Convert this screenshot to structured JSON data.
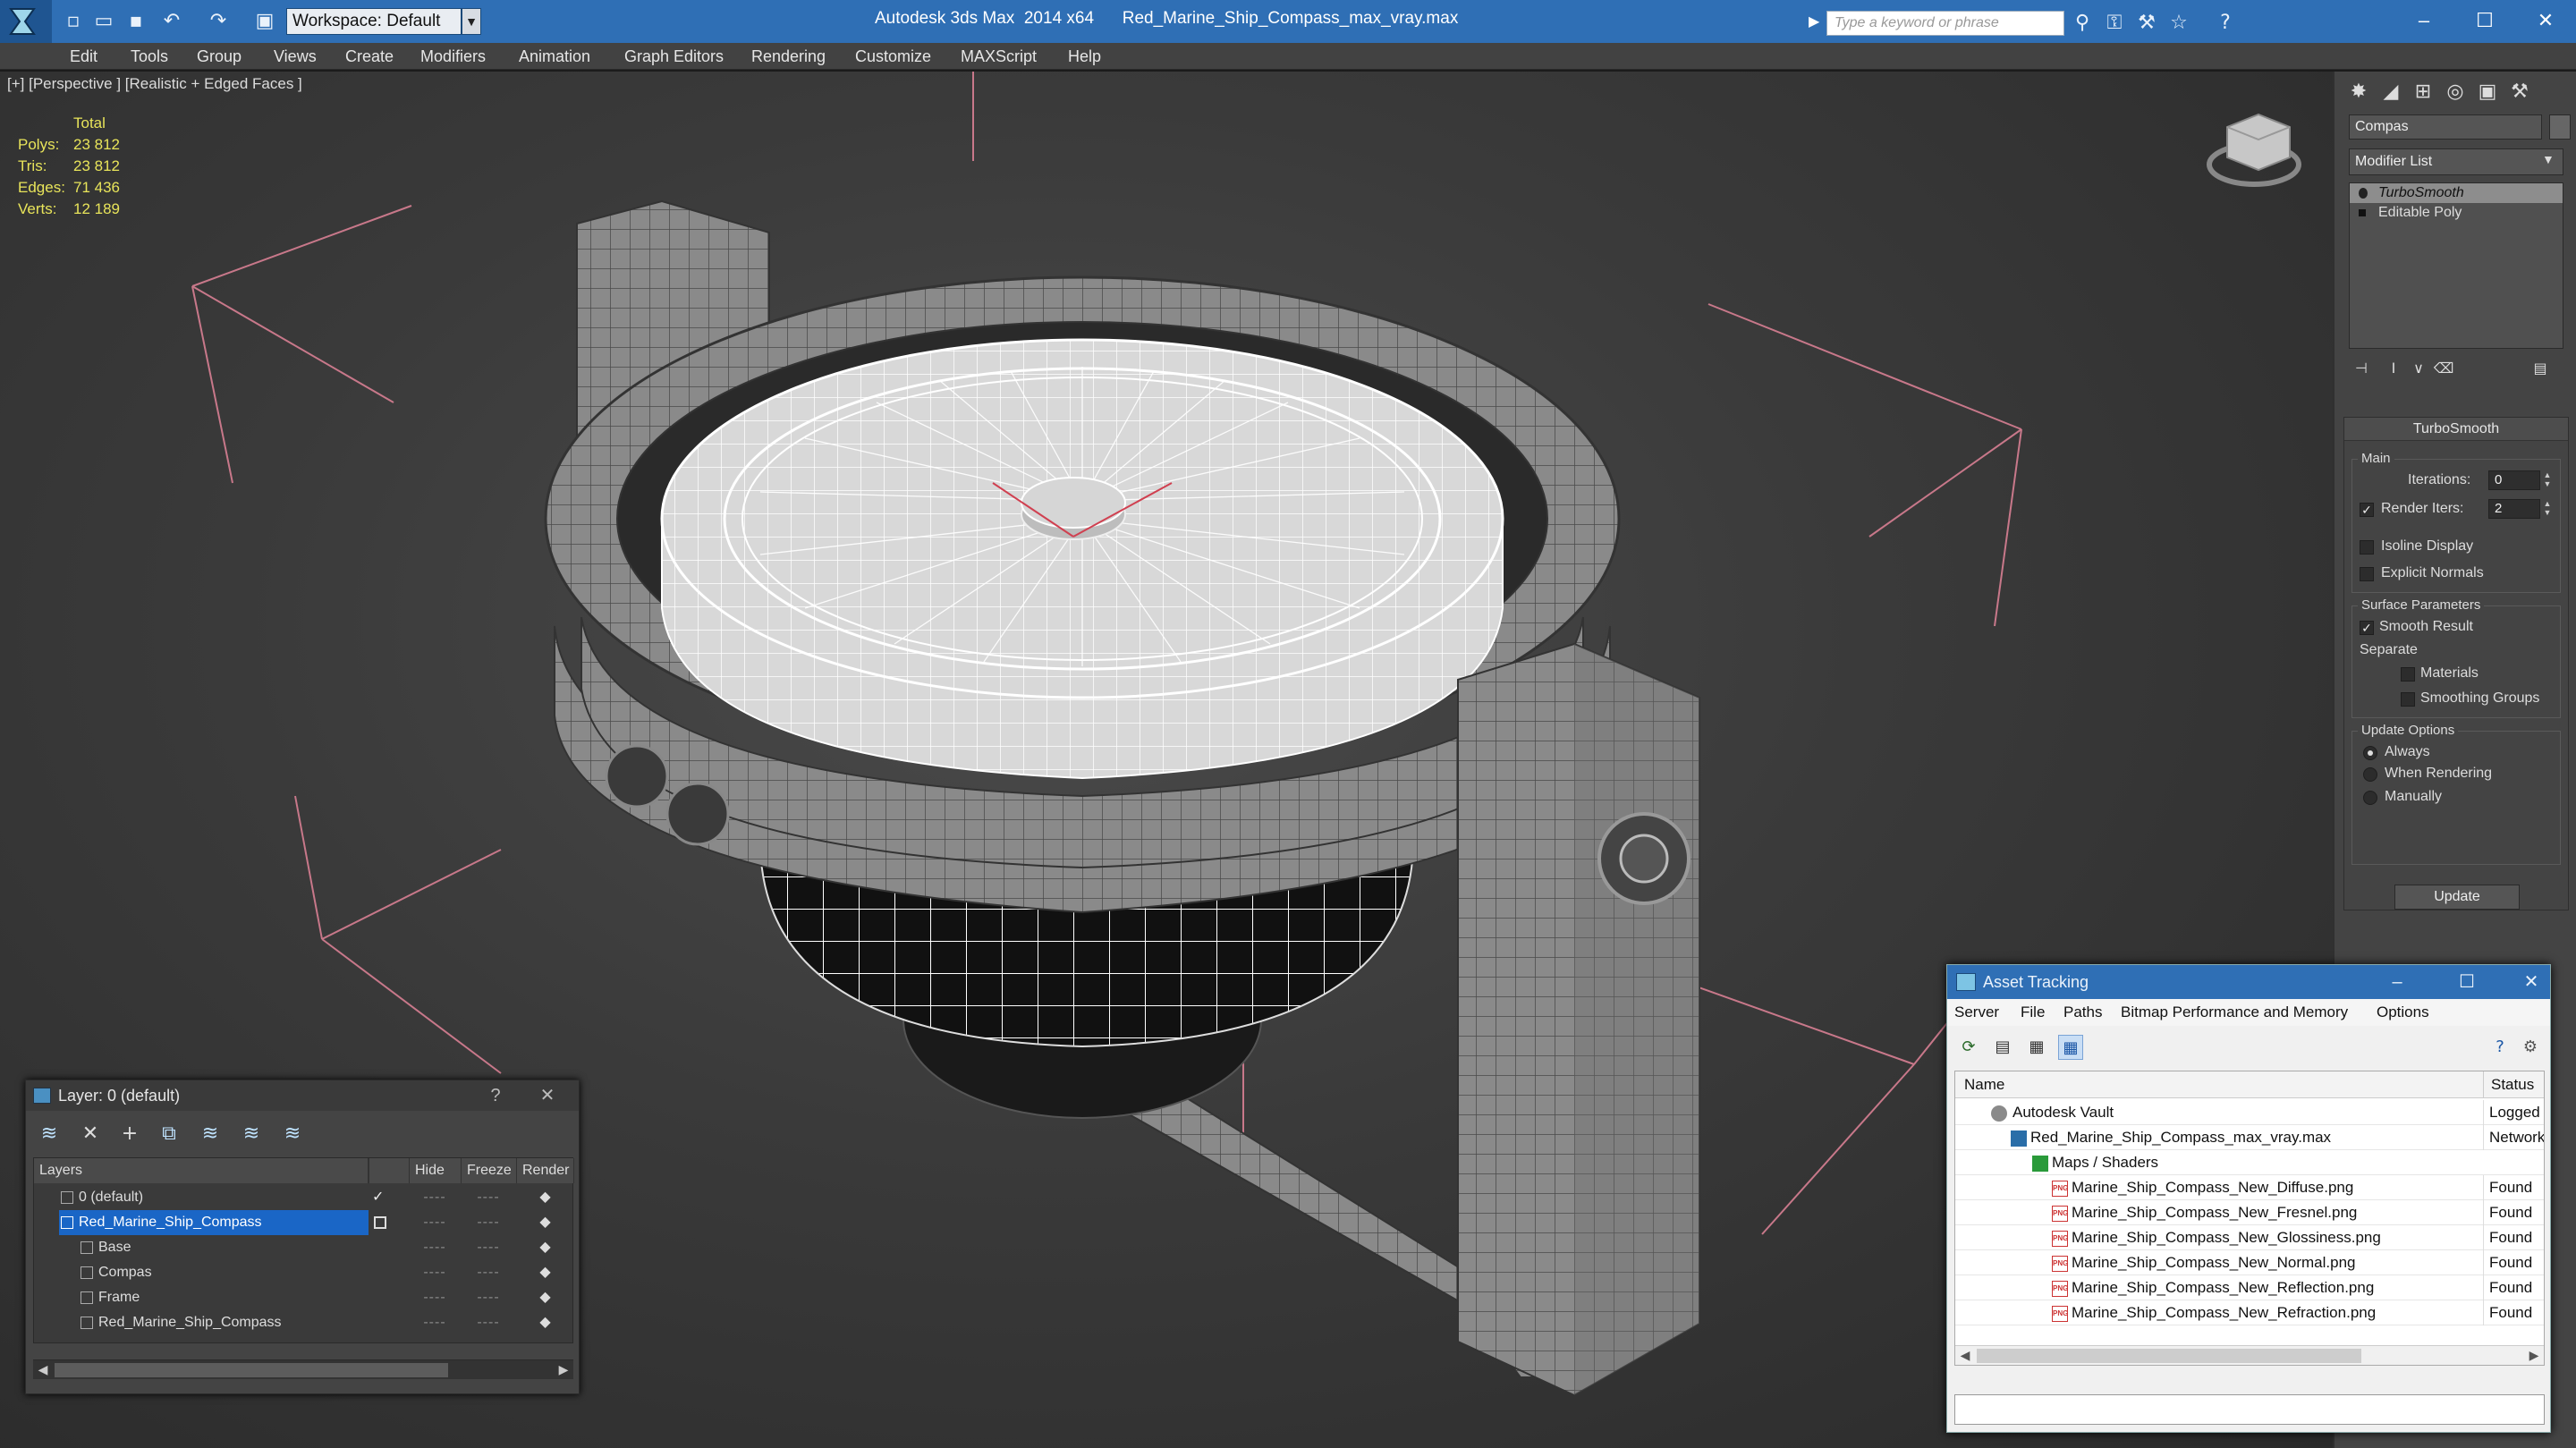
{
  "titlebar": {
    "workspace": "Workspace: Default",
    "app_name": "Autodesk 3ds Max  2014 x64",
    "file_name": "Red_Marine_Ship_Compass_max_vray.max",
    "search_placeholder": "Type a keyword or phrase",
    "accent": "#2f6fb5"
  },
  "menu": [
    "Edit",
    "Tools",
    "Group",
    "Views",
    "Create",
    "Modifiers",
    "Animation",
    "Graph Editors",
    "Rendering",
    "Customize",
    "MAXScript",
    "Help"
  ],
  "viewport": {
    "label": "[+] [Perspective ] [Realistic + Edged Faces ]",
    "stats": {
      "header": "Total",
      "rows": [
        {
          "k": "Polys:",
          "v": "23 812"
        },
        {
          "k": "Tris:",
          "v": "23 812"
        },
        {
          "k": "Edges:",
          "v": "71 436"
        },
        {
          "k": "Verts:",
          "v": "12 189"
        }
      ]
    }
  },
  "command_panel": {
    "object_name": "Compas",
    "modifier_list": "Modifier List",
    "stack": [
      "TurboSmooth",
      "Editable Poly"
    ],
    "rollout_title": "TurboSmooth",
    "main_group": "Main",
    "iterations_label": "Iterations:",
    "iterations_value": "0",
    "render_iters_label": "Render Iters:",
    "render_iters_value": "2",
    "isoline_display": "Isoline Display",
    "explicit_normals": "Explicit Normals",
    "surface_params": "Surface Parameters",
    "smooth_result": "Smooth Result",
    "separate": "Separate",
    "materials": "Materials",
    "smoothing_groups": "Smoothing Groups",
    "update_options": "Update Options",
    "always": "Always",
    "when_rendering": "When Rendering",
    "manually": "Manually",
    "update_btn": "Update"
  },
  "layer_dialog": {
    "title": "Layer: 0 (default)",
    "help": "?",
    "columns": [
      "Layers",
      "Hide",
      "Freeze",
      "Render"
    ],
    "rows": [
      {
        "name": "0 (default)",
        "indent": 1,
        "hide": "----",
        "freeze": "----"
      },
      {
        "name": "Red_Marine_Ship_Compass",
        "indent": 1,
        "selected": true,
        "hide": "----",
        "freeze": "----"
      },
      {
        "name": "Base",
        "indent": 2,
        "hide": "----",
        "freeze": "----"
      },
      {
        "name": "Compas",
        "indent": 2,
        "hide": "----",
        "freeze": "----"
      },
      {
        "name": "Frame",
        "indent": 2,
        "hide": "----",
        "freeze": "----"
      },
      {
        "name": "Red_Marine_Ship_Compass",
        "indent": 2,
        "hide": "----",
        "freeze": "----"
      }
    ]
  },
  "asset_dialog": {
    "title": "Asset Tracking",
    "menu": [
      "Server",
      "File",
      "Paths",
      "Bitmap Performance and Memory",
      "Options"
    ],
    "columns": [
      "Name",
      "Status"
    ],
    "rows": [
      {
        "name": "Autodesk Vault",
        "status": "Logged",
        "icon": "vault",
        "indent": 0
      },
      {
        "name": "Red_Marine_Ship_Compass_max_vray.max",
        "status": "Network",
        "icon": "max",
        "indent": 1
      },
      {
        "name": "Maps / Shaders",
        "status": "",
        "icon": "maps",
        "indent": 2
      },
      {
        "name": "Marine_Ship_Compass_New_Diffuse.png",
        "status": "Found",
        "icon": "png",
        "indent": 3
      },
      {
        "name": "Marine_Ship_Compass_New_Fresnel.png",
        "status": "Found",
        "icon": "png",
        "indent": 3
      },
      {
        "name": "Marine_Ship_Compass_New_Glossiness.png",
        "status": "Found",
        "icon": "png",
        "indent": 3
      },
      {
        "name": "Marine_Ship_Compass_New_Normal.png",
        "status": "Found",
        "icon": "png",
        "indent": 3
      },
      {
        "name": "Marine_Ship_Compass_New_Reflection.png",
        "status": "Found",
        "icon": "png",
        "indent": 3
      },
      {
        "name": "Marine_Ship_Compass_New_Refraction.png",
        "status": "Found",
        "icon": "png",
        "indent": 3
      }
    ]
  }
}
